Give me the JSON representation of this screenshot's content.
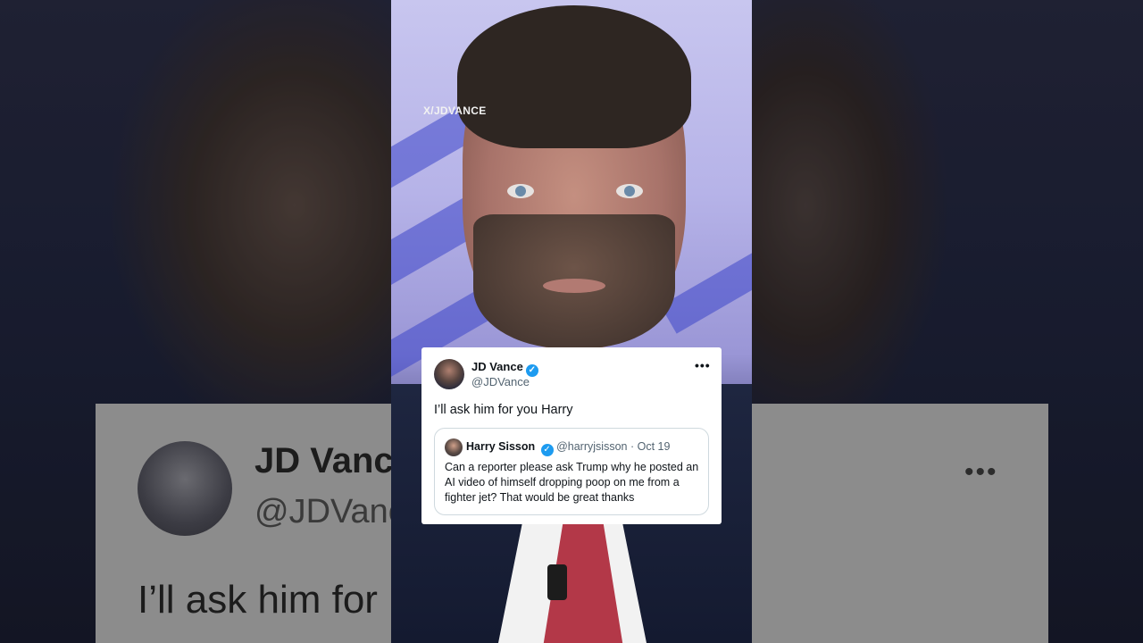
{
  "watermark": "X/JDVANCE",
  "tweet": {
    "author_name": "JD Vance",
    "author_handle": "@JDVance",
    "more_label": "•••",
    "verified_icon": "verified-badge-icon",
    "text": "I’ll ask him for you Harry",
    "quoted": {
      "author_name": "Harry Sisson",
      "author_handle": "@harryjsisson",
      "separator": " · ",
      "date": "Oct 19",
      "text": "Can a reporter please ask Trump why he posted an AI video of himself dropping poop on me from a fighter jet? That would be great thanks"
    }
  },
  "background_blur": {
    "name": "JD Vanc",
    "handle": "@JDVanc",
    "text": "I’ll ask him for",
    "dots": "•••"
  },
  "colors": {
    "verified": "#1d9bf0",
    "text_primary": "#0f1419",
    "text_secondary": "#536471"
  }
}
